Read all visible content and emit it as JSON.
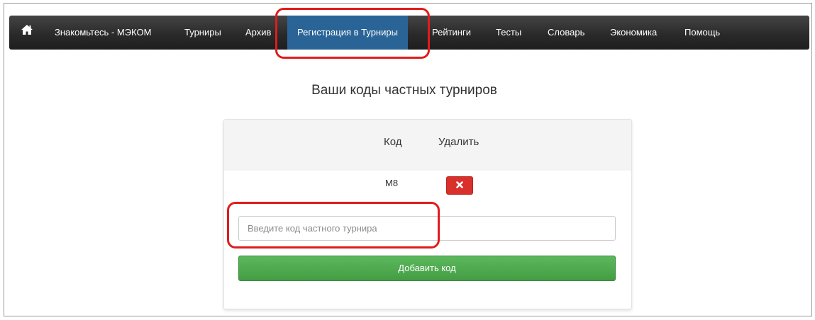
{
  "navbar": {
    "home_icon": "home-icon",
    "items": [
      {
        "label": "Знакомьтесь - МЭКОМ"
      },
      {
        "label": "Турниры"
      },
      {
        "label": "Архив"
      },
      {
        "label": "Регистрация в Турниры",
        "active": true
      },
      {
        "label": "Рейтинги"
      },
      {
        "label": "Тесты"
      },
      {
        "label": "Словарь"
      },
      {
        "label": "Экономика"
      },
      {
        "label": "Помощь"
      }
    ]
  },
  "page": {
    "title": "Ваши коды частных турниров"
  },
  "codes_table": {
    "columns": [
      "Код",
      "Удалить"
    ],
    "rows": [
      {
        "code": "М8",
        "delete_icon": "close-icon"
      }
    ]
  },
  "form": {
    "code_input": {
      "value": "",
      "placeholder": "Введите код частного турнира"
    },
    "add_button_label": "Добавить код"
  },
  "colors": {
    "navbar_bg": "#2a2a2a",
    "active_tab": "#2a6496",
    "highlight": "#e01c1c",
    "delete_button": "#d9302c",
    "add_button": "#4cae4c"
  }
}
